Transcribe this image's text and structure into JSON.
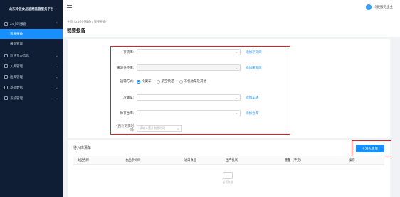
{
  "sidebar": {
    "logo": "山东冷链食品追溯监管服务平台",
    "groups": [
      {
        "label": "24小时报备",
        "expanded": true
      },
      {
        "label": "监管专办信息"
      },
      {
        "label": "入库管理"
      },
      {
        "label": "出库管理"
      },
      {
        "label": "基础数据"
      },
      {
        "label": "系统管理"
      }
    ],
    "subitems": [
      "我要报备",
      "报备管理"
    ]
  },
  "topbar": {
    "user": "冷链服务企业"
  },
  "header": {
    "breadcrumb": "主页 / 24小时报备 / 我要报备",
    "title": "我要报备"
  },
  "form": {
    "warehouse_label": "存货库",
    "warehouse_link": "添加存货库",
    "source_label": "来源供应库",
    "source_link": "添加来源库",
    "transport_label": "运输方式",
    "transport_options": [
      "冷藏车",
      "航空快递",
      "非机动车及其他"
    ],
    "cold_car_label": "冷藏车",
    "cold_car_link": "添加车辆",
    "storage_label": "贮存仓库",
    "storage_link": "添加仓库",
    "arrival_label": "预计到货时间",
    "arrival_placeholder": "请输入预计到货时间"
  },
  "inbound": {
    "title": "待入库清单",
    "add_button": "+ 添入清单",
    "columns": [
      "食品名称",
      "食品条码码",
      "进口食品",
      "生产批次",
      "重量（千克）",
      "操作"
    ],
    "empty": "暂无数据"
  }
}
